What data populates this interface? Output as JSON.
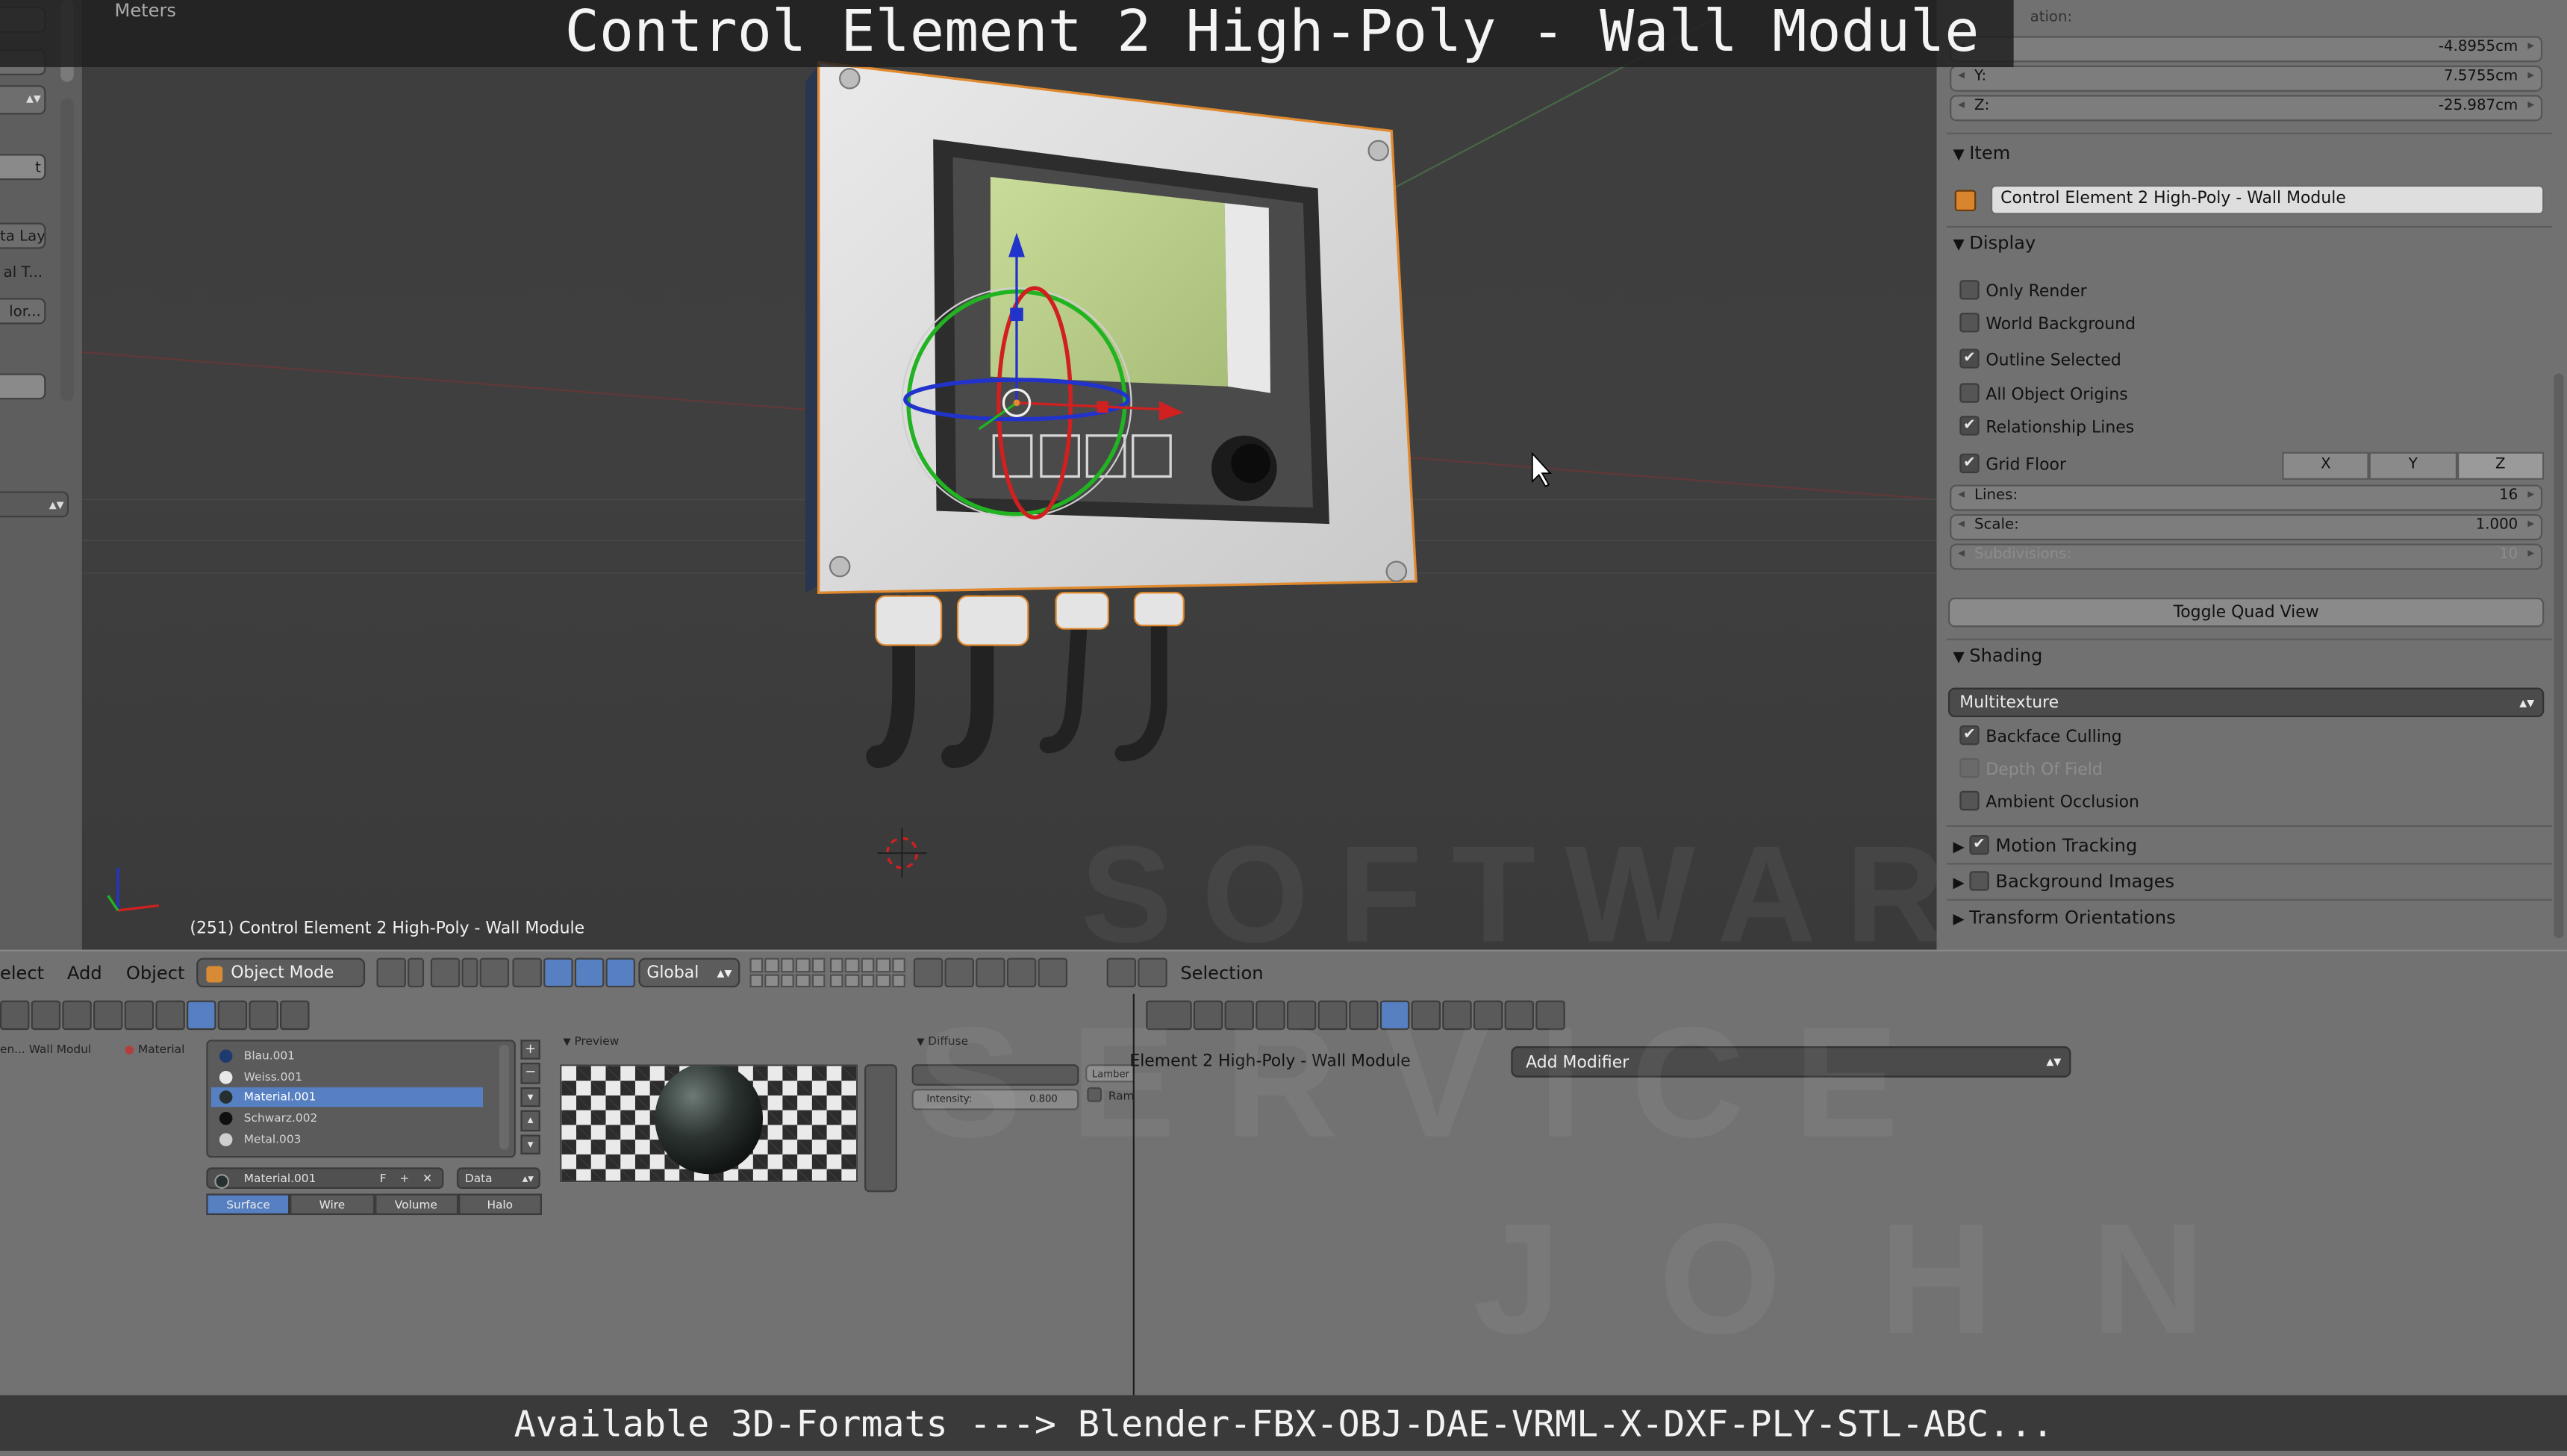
{
  "banner": {
    "title": "Control Element 2 High-Poly - Wall Module",
    "formats": "Available 3D-Formats ---> Blender-FBX-OBJ-DAE-VRML-X-DXF-PLY-STL-ABC..."
  },
  "viewport": {
    "units_label": "Meters",
    "object_status": "(251) Control Element 2 High-Poly - Wall Module",
    "watermark_lines": [
      "SOFTWARE",
      "SERVICE",
      "JOHN"
    ]
  },
  "toolshelf": {
    "partial_labels": [
      "t",
      "ta Lay",
      "al T...",
      "lor..."
    ]
  },
  "npanel": {
    "location_header_partial": "ation:",
    "location": [
      {
        "label": "",
        "value": "-4.8955cm"
      },
      {
        "label": "Y:",
        "value": "7.5755cm"
      },
      {
        "label": "Z:",
        "value": "-25.987cm"
      }
    ],
    "item_header": "Item",
    "object_name": "Control Element 2 High-Poly - Wall Module",
    "display_header": "Display",
    "display_options": [
      {
        "label": "Only Render",
        "checked": false
      },
      {
        "label": "World Background",
        "checked": false
      },
      {
        "label": "Outline Selected",
        "checked": true
      },
      {
        "label": "All Object Origins",
        "checked": false
      },
      {
        "label": "Relationship Lines",
        "checked": true
      },
      {
        "label": "Grid Floor",
        "checked": true
      }
    ],
    "grid_axes": [
      "X",
      "Y",
      "Z"
    ],
    "grid_axes_active": "Z",
    "grid_fields": [
      {
        "label": "Lines:",
        "value": "16"
      },
      {
        "label": "Scale:",
        "value": "1.000"
      },
      {
        "label": "Subdivisions:",
        "value": "10"
      }
    ],
    "toggle_quad": "Toggle Quad View",
    "shading_header": "Shading",
    "shading_mode": "Multitexture",
    "shading_options": [
      {
        "label": "Backface Culling",
        "checked": true,
        "enabled": true
      },
      {
        "label": "Depth Of Field",
        "checked": false,
        "enabled": false
      },
      {
        "label": "Ambient Occlusion",
        "checked": false,
        "enabled": true
      }
    ],
    "collapsed_sections": [
      {
        "label": "Motion Tracking",
        "checked": true
      },
      {
        "label": "Background Images",
        "checked": false
      },
      {
        "label": "Transform Orientations"
      }
    ]
  },
  "header_bar": {
    "menu": [
      "elect",
      "Add",
      "Object"
    ],
    "mode": "Object Mode",
    "orientation": "Global",
    "selection_label": "Selection"
  },
  "properties": {
    "breadcrumb_partial": "en... Wall Modul",
    "breadcrumb_material": "Material",
    "materials": [
      {
        "name": "Blau.001",
        "color": "#1f3a6e",
        "selected": false
      },
      {
        "name": "Weiss.001",
        "color": "#e8e8e8",
        "selected": false
      },
      {
        "name": "Material.001",
        "color": "#263030",
        "selected": true
      },
      {
        "name": "Schwarz.002",
        "color": "#101010",
        "selected": false
      },
      {
        "name": "Metal.003",
        "color": "#cfcfcf",
        "selected": false
      }
    ],
    "material_field": "Material.001",
    "material_field_flag": "F",
    "data_select": "Data",
    "type_tabs": [
      "Surface",
      "Wire",
      "Volume",
      "Halo"
    ],
    "type_active": "Surface",
    "preview_label": "Preview",
    "diffuse_label": "Diffuse",
    "diffuse_shader_partial": "Lamber",
    "ramp_partial": "Ram",
    "intensity_label": "Intensity:",
    "intensity_value": "0.800"
  },
  "modifiers": {
    "object_name_partial": "Element 2 High-Poly - Wall Module",
    "add_modifier": "Add Modifier"
  },
  "colors": {
    "accent_blue": "#5680c2",
    "selection_orange": "#e0892f",
    "gizmo_red": "#d02020",
    "gizmo_green": "#22b322",
    "gizmo_blue": "#2233cc"
  }
}
